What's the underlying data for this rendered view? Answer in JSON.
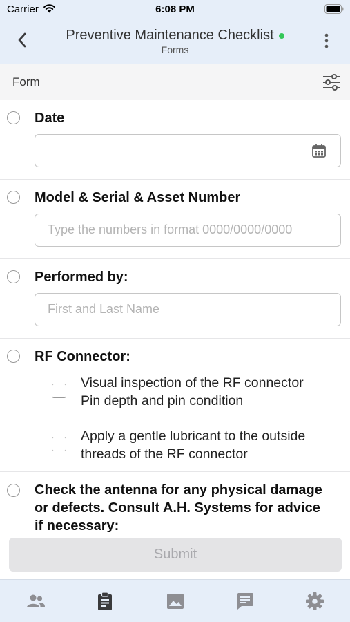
{
  "status_bar": {
    "carrier": "Carrier",
    "time": "6:08 PM"
  },
  "nav": {
    "title": "Preventive Maintenance Checklist",
    "subtitle": "Forms",
    "status_dot_color": "#34c759"
  },
  "form_bar": {
    "label": "Form"
  },
  "questions": [
    {
      "label": "Date",
      "type": "date",
      "value": "",
      "icon": "calendar-icon"
    },
    {
      "label": "Model & Serial & Asset Number",
      "type": "text",
      "placeholder": "Type the numbers in format 0000/0000/0000"
    },
    {
      "label": "Performed by:",
      "type": "text",
      "placeholder": "First and Last Name"
    },
    {
      "label": "RF Connector:",
      "type": "checklist",
      "items": [
        {
          "line1": "Visual inspection of the RF connector",
          "line2": "Pin depth and pin condition",
          "checked": false
        },
        {
          "line1": "Apply a gentle lubricant to the outside",
          "line2": "threads of the RF connector",
          "checked": false
        }
      ]
    },
    {
      "label_lines": [
        "Check the antenna for any physical damage",
        "or defects. Consult A.H. Systems for advice",
        "if necessary:"
      ]
    }
  ],
  "submit": {
    "label": "Submit",
    "enabled": false
  },
  "tabs": [
    {
      "icon": "contacts-icon",
      "active": false
    },
    {
      "icon": "forms-clipboard-icon",
      "active": true
    },
    {
      "icon": "image-icon",
      "active": false
    },
    {
      "icon": "chat-icon",
      "active": false
    },
    {
      "icon": "settings-gear-icon",
      "active": false
    }
  ],
  "colors": {
    "header_bg": "#e6eef9",
    "tab_icon": "#8e8e93",
    "tab_icon_active": "#3a3a3c"
  }
}
